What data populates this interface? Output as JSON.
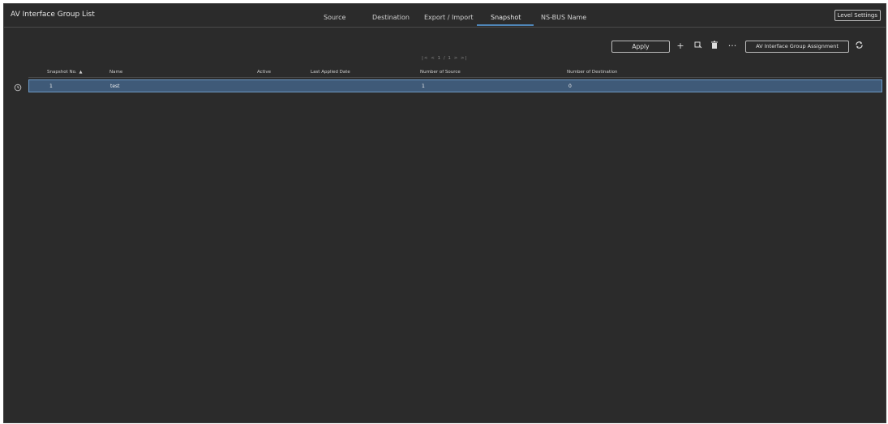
{
  "app": {
    "title": "AV Interface Group List"
  },
  "tabs": [
    {
      "label": "Source"
    },
    {
      "label": "Destination"
    },
    {
      "label": "Export / Import"
    },
    {
      "label": "Snapshot",
      "active": true
    },
    {
      "label": "NS-BUS Name"
    }
  ],
  "header": {
    "level_settings_label": "Level Settings"
  },
  "toolbar": {
    "apply_label": "Apply",
    "add_icon": "plus-icon",
    "copy_icon": "copy-icon",
    "delete_icon": "trash-icon",
    "more_icon": "more-icon",
    "assignment_label": "AV Interface Group Assignment",
    "refresh_icon": "refresh-icon"
  },
  "pager": {
    "first": "|<",
    "prev": "<",
    "page_text": "1 / 1",
    "next": ">",
    "last": ">|"
  },
  "table": {
    "headers": {
      "snapshot_no": "Snapshot No.",
      "name": "Name",
      "active": "Active",
      "last_applied_date": "Last Applied Date",
      "number_of_source": "Number of Source",
      "number_of_destination": "Number of Destination"
    },
    "sort_indicator": "▲",
    "rows": [
      {
        "snapshot_no": "1",
        "name": "test",
        "active": "",
        "last_applied_date": "",
        "number_of_source": "1",
        "number_of_destination": "0"
      }
    ]
  },
  "colors": {
    "accent": "#4f86b8",
    "selected_row": "#3f5a78",
    "background": "#2b2b2b"
  }
}
